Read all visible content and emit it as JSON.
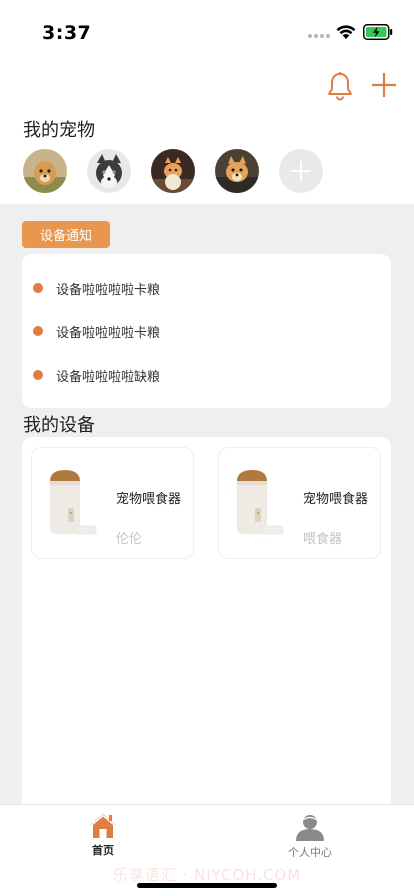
{
  "status_bar": {
    "time": "3:37"
  },
  "colors": {
    "accent": "#e8974d",
    "dot": "#e07d44",
    "grey_bg": "#efefef"
  },
  "header": {
    "icons": [
      "bell-icon",
      "plus-icon"
    ]
  },
  "pets": {
    "title": "我的宠物",
    "avatars": [
      "pet-avatar-1",
      "pet-avatar-2",
      "pet-avatar-3",
      "pet-avatar-4"
    ],
    "add_icon": "add-pet-icon"
  },
  "notifications": {
    "tag": "设备通知",
    "items": [
      "设备啦啦啦啦卡粮",
      "设备啦啦啦啦卡粮",
      "设备啦啦啦啦缺粮"
    ]
  },
  "devices": {
    "title": "我的设备",
    "items": [
      {
        "name": "宠物喂食器",
        "sub": "伦伦"
      },
      {
        "name": "宠物喂食器",
        "sub": "喂食器"
      }
    ]
  },
  "tab_bar": {
    "tabs": [
      {
        "label": "首页",
        "icon": "home-icon",
        "active": true
      },
      {
        "label": "个人中心",
        "icon": "user-icon",
        "active": false
      }
    ]
  },
  "watermark": "乐享语汇 · NIYCOH.COM"
}
